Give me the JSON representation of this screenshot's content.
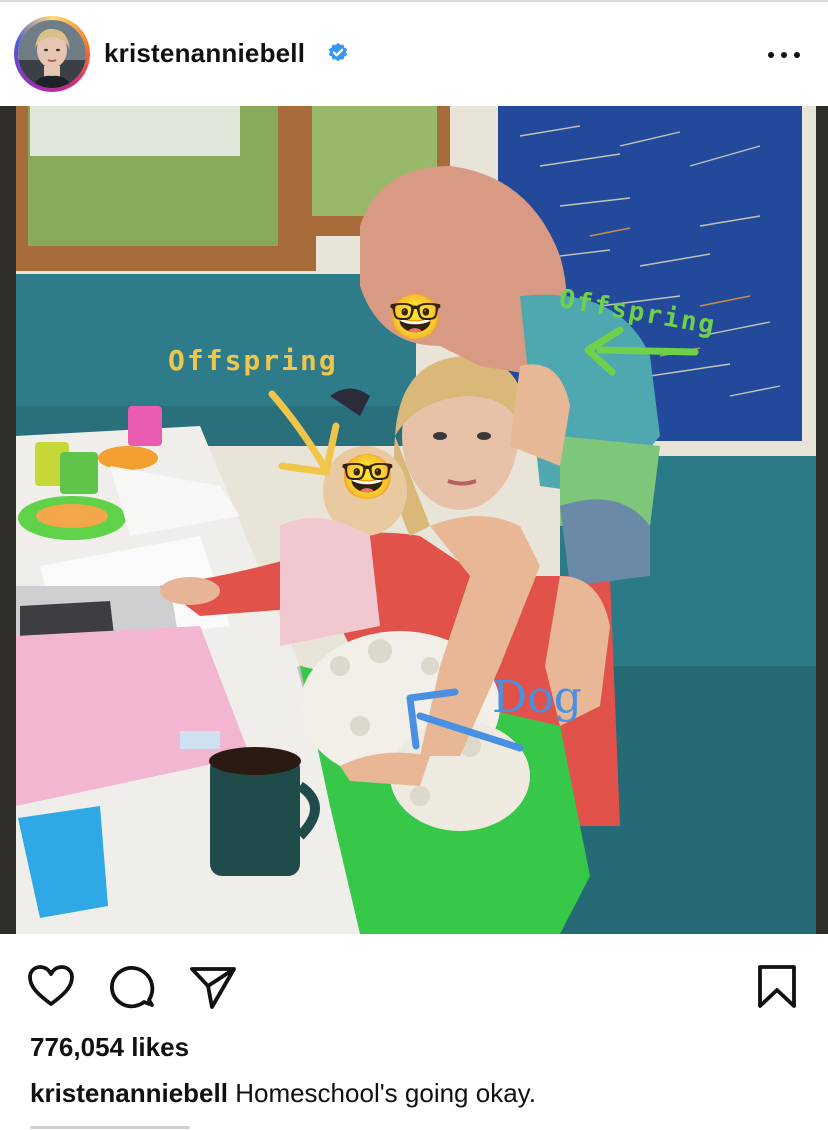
{
  "post": {
    "username": "kristenanniebell",
    "verified_icon": "verified-badge-icon",
    "more_icon": "more-options-icon"
  },
  "photo": {
    "annotations": {
      "offspring_left": "Offspring",
      "offspring_right": "Offspring",
      "dog": "Dog"
    },
    "emoji": "🤓",
    "colors": {
      "offspring_left": "#f0c64a",
      "offspring_right": "#6fd14a",
      "dog": "#4a90e2"
    }
  },
  "actions": {
    "like_icon": "heart-icon",
    "comment_icon": "comment-icon",
    "share_icon": "send-icon",
    "save_icon": "bookmark-icon"
  },
  "likes": "776,054 likes",
  "caption": {
    "username": "kristenanniebell",
    "text": "Homeschool's going okay."
  },
  "colors": {
    "verified": "#3897f0",
    "text": "#111111"
  }
}
